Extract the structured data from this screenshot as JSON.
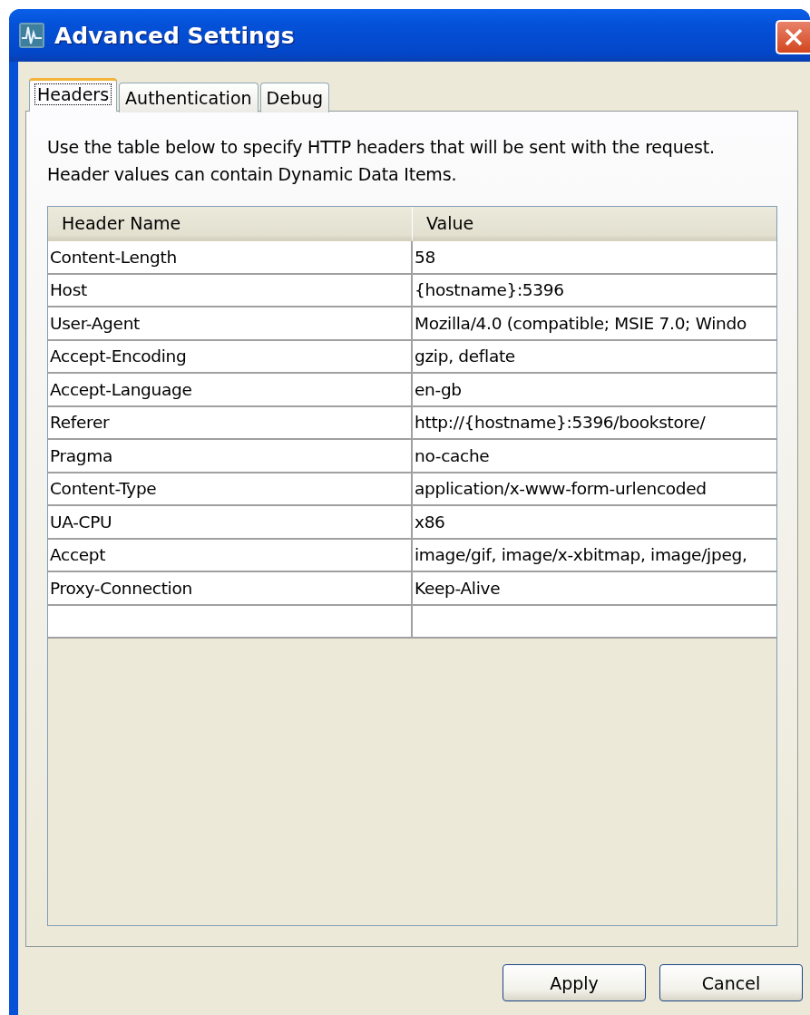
{
  "window": {
    "title": "Advanced Settings"
  },
  "tabs": [
    {
      "label": "Headers",
      "selected": true
    },
    {
      "label": "Authentication",
      "selected": false
    },
    {
      "label": "Debug",
      "selected": false
    }
  ],
  "description": [
    "Use the table below to specify HTTP headers that will be sent with the request.",
    "Header values can contain Dynamic Data Items."
  ],
  "table": {
    "columns": [
      "Header Name",
      "Value"
    ],
    "rows": [
      {
        "name": "Content-Length",
        "value": "58"
      },
      {
        "name": "Host",
        "value": "{hostname}:5396"
      },
      {
        "name": "User-Agent",
        "value": "Mozilla/4.0 (compatible; MSIE 7.0; Windo"
      },
      {
        "name": "Accept-Encoding",
        "value": "gzip, deflate"
      },
      {
        "name": "Accept-Language",
        "value": "en-gb"
      },
      {
        "name": "Referer",
        "value": "http://{hostname}:5396/bookstore/"
      },
      {
        "name": "Pragma",
        "value": "no-cache"
      },
      {
        "name": "Content-Type",
        "value": "application/x-www-form-urlencoded"
      },
      {
        "name": "UA-CPU",
        "value": "x86"
      },
      {
        "name": "Accept",
        "value": "image/gif, image/x-xbitmap, image/jpeg,"
      },
      {
        "name": "Proxy-Connection",
        "value": "Keep-Alive"
      }
    ]
  },
  "buttons": [
    "Apply",
    "Cancel"
  ]
}
